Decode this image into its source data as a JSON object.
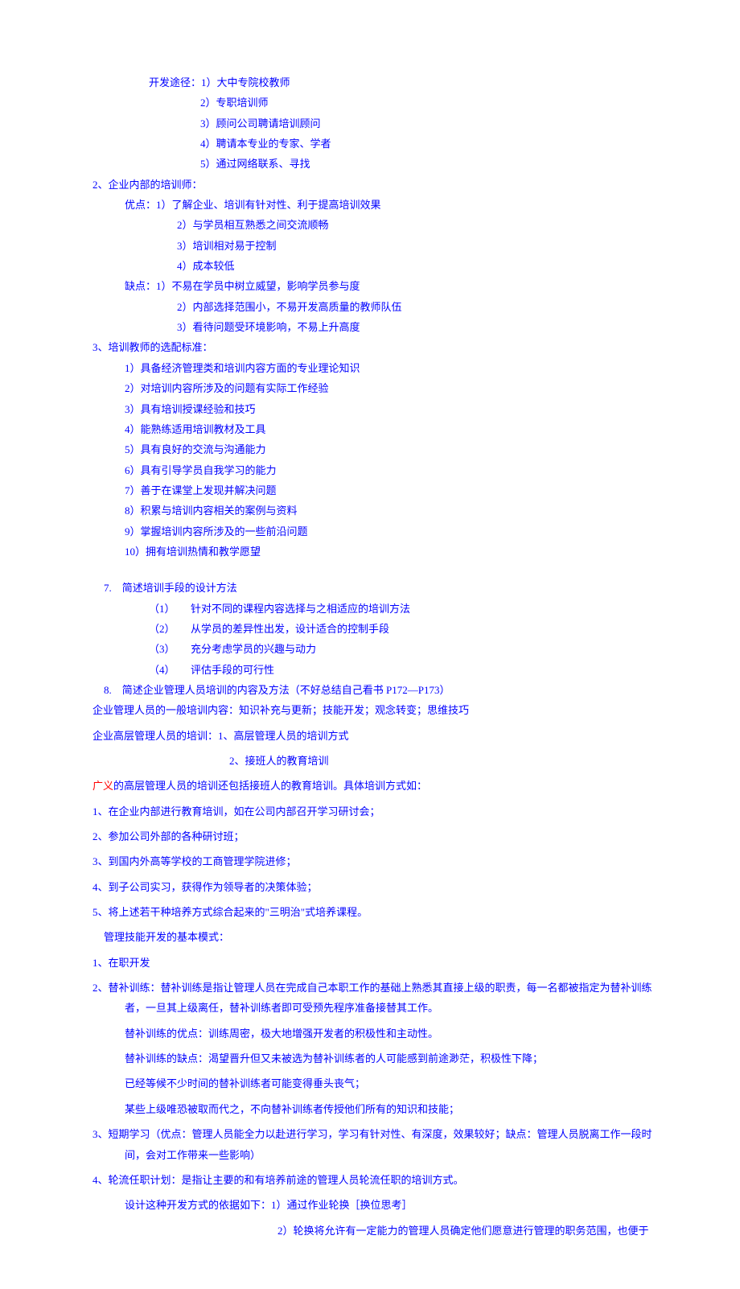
{
  "s1": {
    "l1": "开发途径：1）大中专院校教师",
    "l2": "2）专职培训师",
    "l3": "3）顾问公司聘请培训顾问",
    "l4": "4）聘请本专业的专家、学者",
    "l5": "5）通过网络联系、寻找"
  },
  "s2": {
    "h": "2、企业内部的培训师：",
    "y1": "优点：1）了解企业、培训有针对性、利于提高培训效果",
    "y2": "2）与学员相互熟悉之间交流顺畅",
    "y3": "3）培训相对易于控制",
    "y4": "4）成本较低",
    "q1": "缺点：1）不易在学员中树立威望，影响学员参与度",
    "q2": "2）内部选择范围小，不易开发高质量的教师队伍",
    "q3": "3）看待问题受环境影响，不易上升高度"
  },
  "s3": {
    "h": "3、培训教师的选配标准：",
    "l1": "1）具备经济管理类和培训内容方面的专业理论知识",
    "l2": "2）对培训内容所涉及的问题有实际工作经验",
    "l3": "3）具有培训授课经验和技巧",
    "l4": "4）能熟练适用培训教材及工具",
    "l5": "5）具有良好的交流与沟通能力",
    "l6": "6）具有引导学员自我学习的能力",
    "l7": "7）善于在课堂上发现并解决问题",
    "l8": "8）积累与培训内容相关的案例与资料",
    "l9": "9）掌握培训内容所涉及的一些前沿问题",
    "l10": "10）拥有培训热情和教学愿望"
  },
  "s7": {
    "h": "7.　简述培训手段的设计方法",
    "l1": "（1）　　针对不同的课程内容选择与之相适应的培训方法",
    "l2": "（2）　　从学员的差异性出发，设计适合的控制手段",
    "l3": "（3）　　充分考虑学员的兴趣与动力",
    "l4": "（4）　　评估手段的可行性"
  },
  "s8": {
    "h": "8.　简述企业管理人员培训的内容及方法（不好总结自己看书 P172—P173）"
  },
  "p1": "企业管理人员的一般培训内容：知识补充与更新；技能开发；观念转变；思维技巧",
  "p2": "企业高层管理人员的培训：1、高层管理人员的培训方式",
  "p3": "2、接班人的教育培训",
  "p4a": "广义",
  "p4b": "的高层管理人员的培训还包括接班人的教育培训。具体培训方式如：",
  "p5": "1、在企业内部进行教育培训，如在公司内部召开学习研讨会；",
  "p6": "2、参加公司外部的各种研讨班；",
  "p7": "3、到国内外高等学校的工商管理学院进修；",
  "p8": "4、到子公司实习，获得作为领导者的决策体验；",
  "p9": "5、将上述若干种培养方式综合起来的\"三明治\"式培养课程。",
  "p10": "管理技能开发的基本模式：",
  "p11": "1、在职开发",
  "s12": {
    "l1": "2、替补训练：替补训练是指让管理人员在完成自己本职工作的基础上熟悉其直接上级的职责，每一名都被指定为替补训练者，一旦其上级离任，替补训练者即可受预先程序准备接替其工作。",
    "l2": "替补训练的优点：训练周密，极大地增强开发者的积极性和主动性。",
    "l3": "替补训练的缺点：渴望晋升但又未被选为替补训练者的人可能感到前途渺茫，积极性下降；",
    "l4": "已经等候不少时间的替补训练者可能变得垂头丧气；",
    "l5": "某些上级唯恐被取而代之，不向替补训练者传授他们所有的知识和技能；"
  },
  "p13": "3、短期学习（优点：管理人员能全力以赴进行学习，学习有针对性、有深度，效果较好；缺点：管理人员脱离工作一段时间，会对工作带来一些影响）",
  "s14": {
    "l1": "4、轮流任职计划：是指让主要的和有培养前途的管理人员轮流任职的培训方式。",
    "l2": "设计这种开发方式的依据如下：1）通过作业轮换［换位思考］",
    "l3": "2）轮换将允许有一定能力的管理人员确定他们愿意进行管理的职务范围，也便于"
  }
}
